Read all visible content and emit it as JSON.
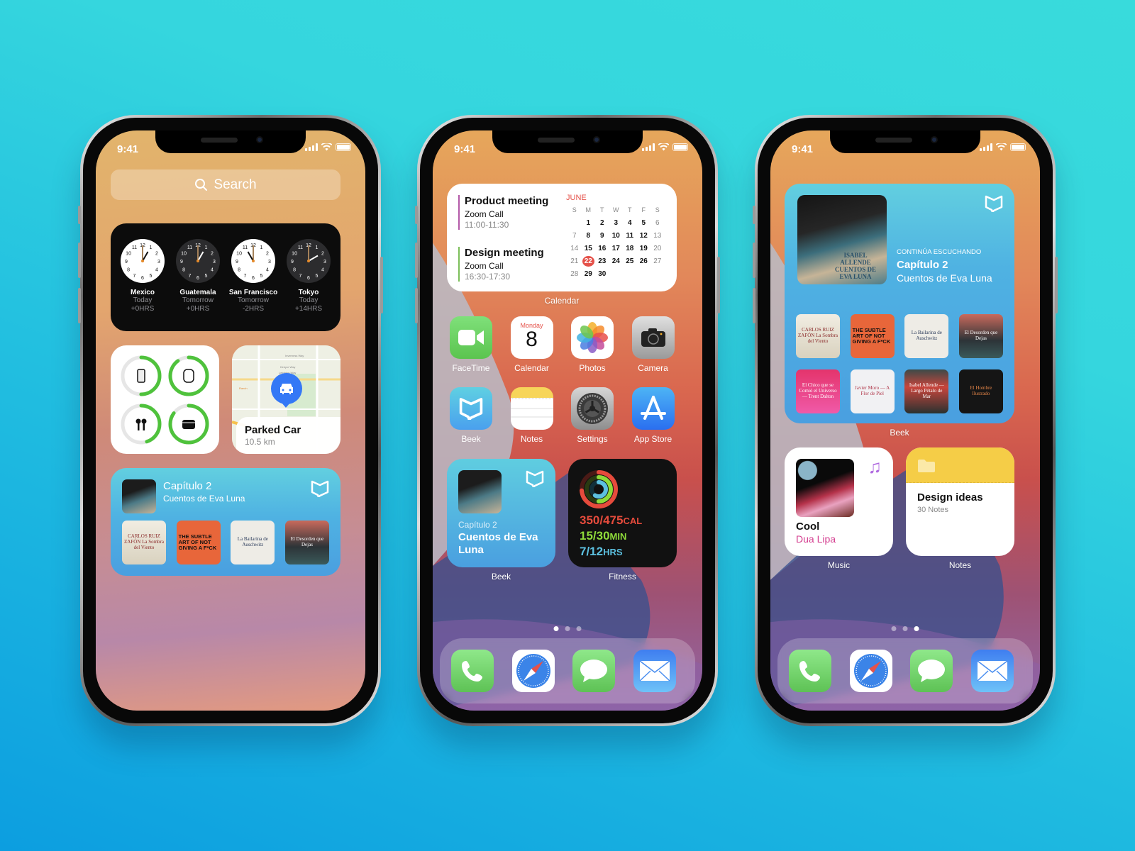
{
  "status_bar": {
    "time": "9:41"
  },
  "phone1": {
    "search": {
      "placeholder": "Search"
    },
    "world_clock": {
      "cities": [
        {
          "name": "Mexico",
          "day": "Today",
          "offset": "+0HRS",
          "theme": "light"
        },
        {
          "name": "Guatemala",
          "day": "Tomorrow",
          "offset": "+0HRS",
          "theme": "dark"
        },
        {
          "name": "San Francisco",
          "day": "Tomorrow",
          "offset": "-2HRS",
          "theme": "light"
        },
        {
          "name": "Tokyo",
          "day": "Today",
          "offset": "+14HRS",
          "theme": "dark"
        }
      ]
    },
    "batteries": {
      "devices": [
        {
          "icon": "iphone-icon",
          "level": 0.5
        },
        {
          "icon": "watch-icon",
          "level": 0.9
        },
        {
          "icon": "airpods-icon",
          "level": 0.45
        },
        {
          "icon": "airpods-case-icon",
          "level": 0.85
        }
      ]
    },
    "maps": {
      "title": "Parked Car",
      "distance": "10.5 km",
      "streets": [
        "Inverness Way",
        "Kintyre Way",
        "Leighton Way",
        "Loma Way",
        "N Tantau Ave",
        "Ranch"
      ]
    },
    "beek": {
      "chapter": "Capítulo 2",
      "book": "Cuentos de Eva Luna",
      "books": [
        {
          "title": "CARLOS RUIZ ZAFÓN La Sombra del Viento"
        },
        {
          "title": "THE SUBTLE ART OF NOT GIVING A F*CK"
        },
        {
          "title": "La Bailarina de Auschwitz"
        },
        {
          "title": "El Desorden que Dejas"
        }
      ]
    }
  },
  "phone2": {
    "calendar_widget": {
      "label": "Calendar",
      "month": "JUNE",
      "weekdays": [
        "S",
        "M",
        "T",
        "W",
        "T",
        "F",
        "S"
      ],
      "today": 22,
      "events": [
        {
          "title": "Product meeting",
          "subtitle": "Zoom Call",
          "time": "11:00-11:30",
          "color": "#b45aa8"
        },
        {
          "title": "Design meeting",
          "subtitle": "Zoom Call",
          "time": "16:30-17:30",
          "color": "#7cbf5a"
        }
      ]
    },
    "apps": [
      {
        "name": "FaceTime",
        "icon": "facetime-icon"
      },
      {
        "name": "Calendar",
        "icon": "calendar-icon",
        "day": "Monday",
        "date": "8"
      },
      {
        "name": "Photos",
        "icon": "photos-icon"
      },
      {
        "name": "Camera",
        "icon": "camera-icon"
      },
      {
        "name": "Beek",
        "icon": "beek-icon"
      },
      {
        "name": "Notes",
        "icon": "notes-icon"
      },
      {
        "name": "Settings",
        "icon": "settings-icon"
      },
      {
        "name": "App Store",
        "icon": "app-store-icon"
      }
    ],
    "beek_widget": {
      "label": "Beek",
      "chapter": "Capítulo 2",
      "book": "Cuentos de Eva Luna"
    },
    "fitness_widget": {
      "label": "Fitness",
      "move": "350/475",
      "move_unit": "CAL",
      "move_progress": 0.737,
      "exercise": "15/30",
      "exercise_unit": "MIN",
      "exercise_progress": 0.5,
      "stand": "7/12",
      "stand_unit": "HRS",
      "stand_progress": 0.583
    },
    "page_dots": {
      "count": 3,
      "active": 0
    }
  },
  "phone3": {
    "beek_widget": {
      "label": "Beek",
      "kicker": "CONTINÚA ESCUCHANDO",
      "chapter": "Capítulo 2",
      "book": "Cuentos de Eva Luna",
      "cover": "ISABEL ALLENDE CUENTOS DE EVA LUNA",
      "books": [
        {
          "title": "CARLOS RUIZ ZAFÓN La Sombra del Viento"
        },
        {
          "title": "THE SUBTLE ART OF NOT GIVING A F*CK"
        },
        {
          "title": "La Bailarina de Auschwitz"
        },
        {
          "title": "El Desorden que Dejas"
        },
        {
          "title": "El Chico que se Comió el Universo — Trent Dalton"
        },
        {
          "title": "Javier Moro — A Flor de Piel"
        },
        {
          "title": "Isabel Allende — Largo Pétalo de Mar"
        },
        {
          "title": "El Hombre Ilustrado"
        }
      ]
    },
    "music_widget": {
      "label": "Music",
      "song": "Cool",
      "artist": "Dua Lipa"
    },
    "notes_widget": {
      "label": "Notes",
      "title": "Design ideas",
      "count": "30 Notes"
    },
    "page_dots": {
      "count": 3,
      "active": 2
    }
  },
  "dock": [
    "Phone",
    "Safari",
    "Messages",
    "Mail"
  ],
  "colors": {
    "background": "#22bfe0",
    "beek_blue": "#4aa3e0",
    "calendar_red": "#e5524a",
    "music_pink": "#d43d8f",
    "notes_yellow": "#f5cd47"
  }
}
